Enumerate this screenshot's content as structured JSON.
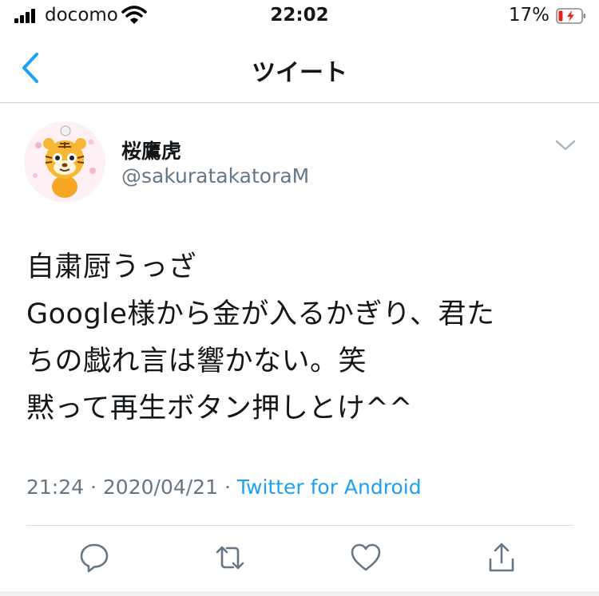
{
  "status_bar": {
    "carrier": "docomo",
    "time": "22:02",
    "battery_percent": "17%"
  },
  "nav": {
    "title": "ツイート"
  },
  "tweet": {
    "display_name": "桜鷹虎",
    "handle": "@sakuratakatoraM",
    "text_lines": [
      "自粛厨うっざ",
      "Google様から金が入るかぎり、君た",
      "ちの戯れ言は響かない。笑",
      "黙って再生ボタン押しとけ^^"
    ],
    "time": "21:24",
    "separator": "·",
    "date": "2020/04/21",
    "source": "Twitter for Android"
  },
  "icons": {
    "reply": "reply-icon",
    "retweet": "retweet-icon",
    "like": "heart-icon",
    "share": "share-icon"
  },
  "colors": {
    "accent": "#1da1f2",
    "secondary_text": "#657786",
    "battery_low": "#e0241a"
  }
}
